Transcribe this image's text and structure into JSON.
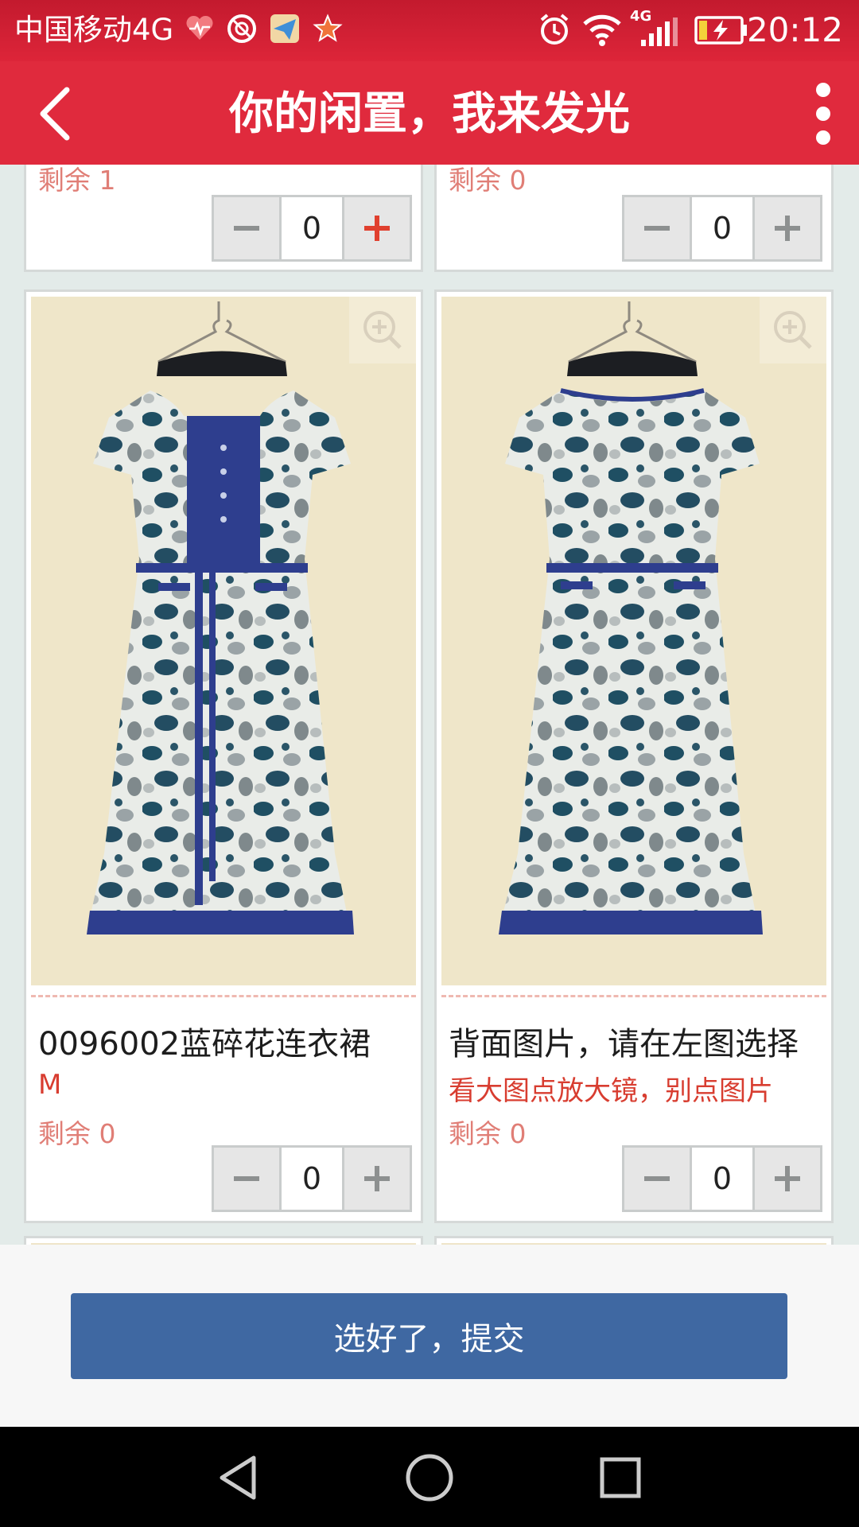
{
  "status_bar": {
    "carrier": "中国移动4G",
    "network": "4G",
    "time": "20:12",
    "icons": [
      "health-heart-icon",
      "app-icon",
      "paper-plane-icon",
      "star-app-icon",
      "alarm-icon",
      "wifi-icon",
      "signal-icon",
      "battery-charging-icon"
    ]
  },
  "header": {
    "title": "你的闲置，我来发光",
    "back_icon": "back-arrow-icon",
    "more_icon": "more-vertical-icon"
  },
  "top_row": [
    {
      "remaining": "剩余 1",
      "quantity": "0",
      "plus_active": true
    },
    {
      "remaining": "剩余 0",
      "quantity": "0",
      "plus_active": false
    }
  ],
  "products": [
    {
      "name": "0096002蓝碎花连衣裙",
      "variant": "M",
      "remaining": "剩余 0",
      "quantity": "0"
    },
    {
      "name": "背面图片，请在左图选择",
      "variant": "看大图点放大镜，别点图片",
      "remaining": "剩余 0",
      "quantity": "0"
    }
  ],
  "colors": {
    "header_red": "#e02a3d",
    "accent_red": "#d83d30",
    "remaining_text": "#e07e76",
    "submit_blue": "#3f68a2"
  },
  "submit": {
    "label": "选好了，提交"
  },
  "nav": {
    "icons": [
      "nav-back-icon",
      "nav-home-icon",
      "nav-recents-icon"
    ]
  }
}
